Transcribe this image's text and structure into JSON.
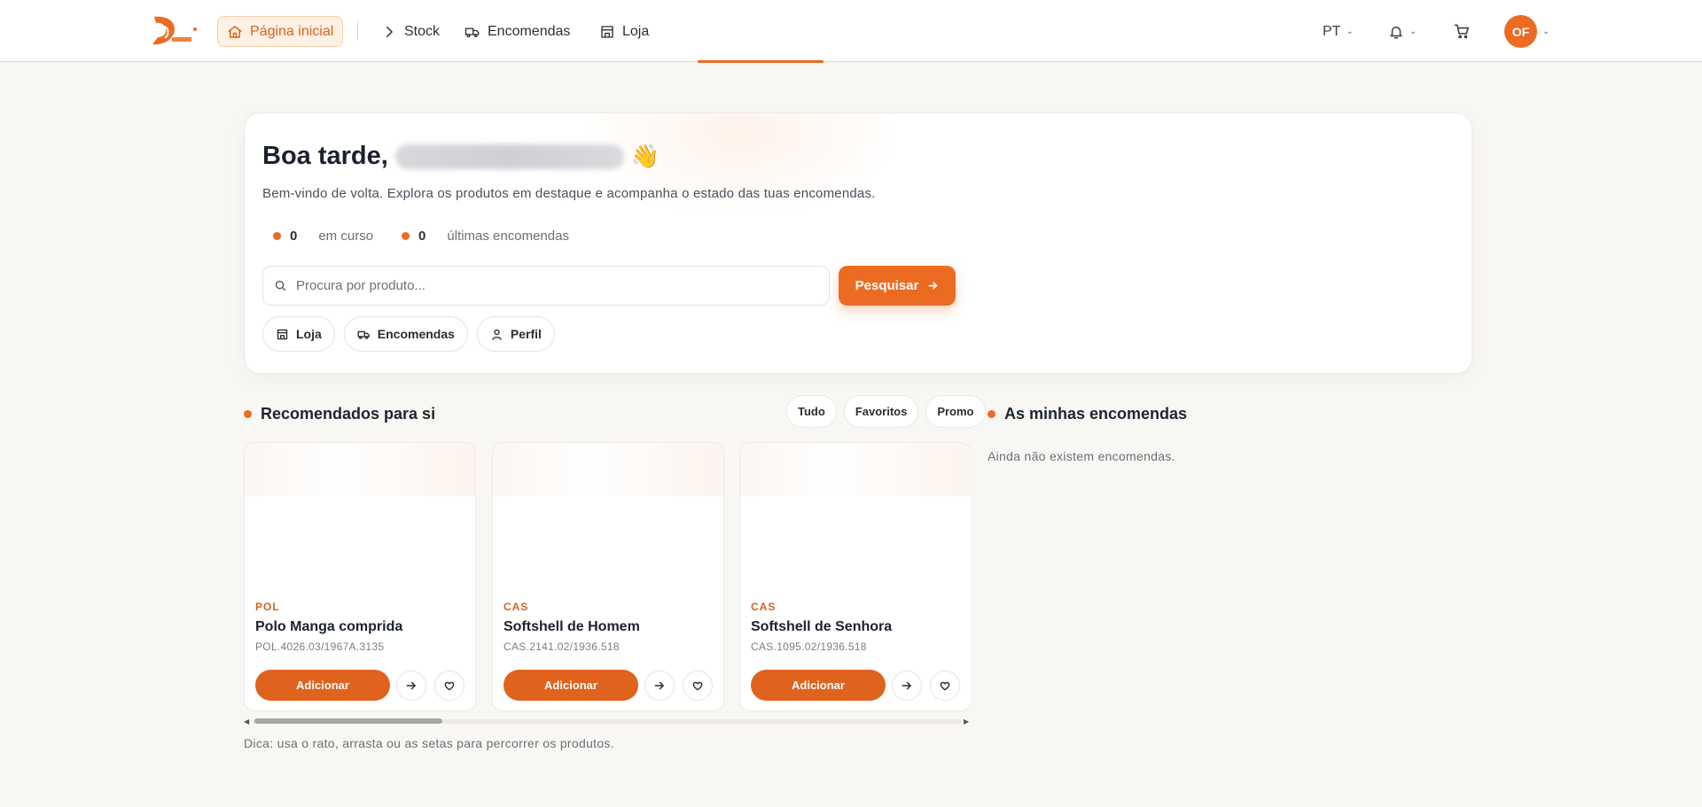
{
  "nav": {
    "home": "Página inicial",
    "stock": "Stock",
    "orders": "Encomendas",
    "store": "Loja",
    "lang": "PT",
    "avatar_initials": "OF",
    "brand_color": "#ec6b23"
  },
  "hero": {
    "greeting": "Boa tarde,",
    "wave": "👋",
    "subtitle": "Bem-vindo de volta. Explora os produtos em destaque e acompanha o estado das tuas encomendas.",
    "stats": [
      {
        "value": "0",
        "label": "em curso"
      },
      {
        "value": "0",
        "label": "últimas encomendas"
      }
    ],
    "search_placeholder": "Procura por produto...",
    "search_button": "Pesquisar",
    "quick_links": [
      "Loja",
      "Encomendas",
      "Perfil"
    ]
  },
  "recommended": {
    "title": "Recomendados para si",
    "filters": [
      "Tudo",
      "Favoritos",
      "Promo"
    ],
    "products": [
      {
        "category": "POL",
        "name": "Polo Manga comprida",
        "ref": "POL.4026.03/1967A.3135",
        "add": "Adicionar"
      },
      {
        "category": "CAS",
        "name": "Softshell de Homem",
        "ref": "CAS.2141.02/1936.518",
        "add": "Adicionar"
      },
      {
        "category": "CAS",
        "name": "Softshell de Senhora",
        "ref": "CAS.1095.02/1936.518",
        "add": "Adicionar"
      }
    ],
    "hint": "Dica: usa o rato, arrasta ou as setas para percorrer os produtos."
  },
  "orders": {
    "title": "As minhas encomendas",
    "empty": "Ainda não existem encomendas."
  }
}
